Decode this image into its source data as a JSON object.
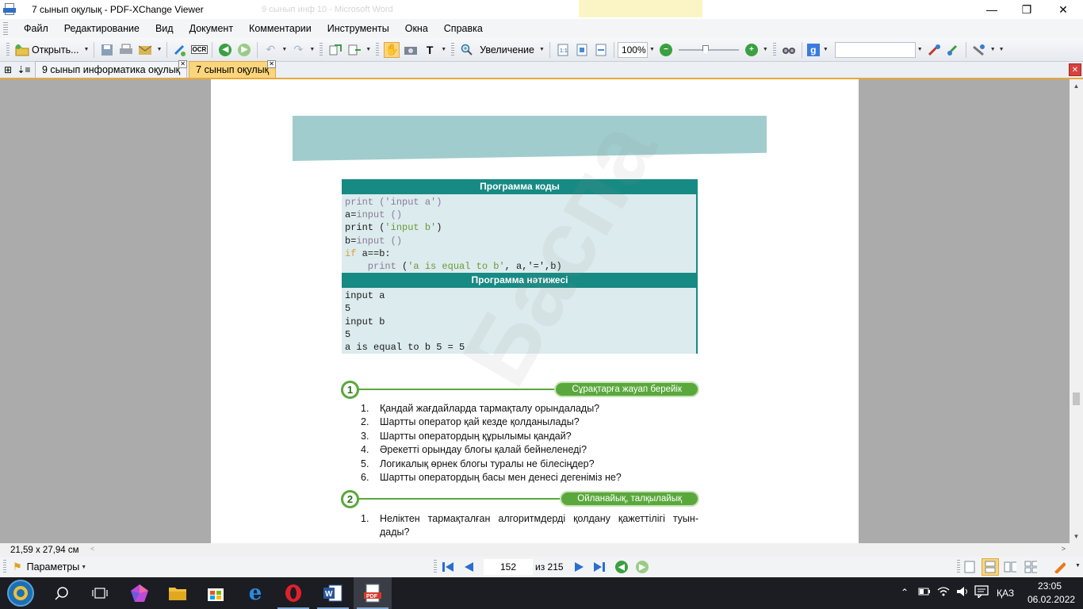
{
  "window": {
    "title": "7 сынып оқулық - PDF-XChange Viewer",
    "background_window_title": "9 сынып инф 10 - Microsoft Word",
    "minimize": "—",
    "maximize": "❐",
    "close": "✕"
  },
  "menu": [
    "Файл",
    "Редактирование",
    "Вид",
    "Документ",
    "Комментарии",
    "Инструменты",
    "Окна",
    "Справка"
  ],
  "toolbar": {
    "open_label": "Открыть...",
    "ocr_label": "OCR",
    "zoom_tool_label": "Увеличение",
    "zoom_value": "100%",
    "search_value": ""
  },
  "tabs": [
    {
      "label": "9 сынып информатика оқулық",
      "active": false
    },
    {
      "label": "7 сынып оқулық",
      "active": true
    }
  ],
  "document": {
    "watermark": "Баспа",
    "code_header": "Программа коды",
    "code_lines": [
      [
        {
          "t": "print ",
          "c": "kw-fn"
        },
        {
          "t": "('input a')",
          "c": "kw-fn"
        }
      ],
      [
        {
          "t": "a=",
          "c": "plain"
        },
        {
          "t": "input",
          "c": "kw-fn"
        },
        {
          "t": " ()",
          "c": "kw-fn"
        }
      ],
      [
        {
          "t": "print ",
          "c": "plain"
        },
        {
          "t": "(",
          "c": "plain"
        },
        {
          "t": "'input b'",
          "c": "kw-str"
        },
        {
          "t": ")",
          "c": "plain"
        }
      ],
      [
        {
          "t": "b=",
          "c": "plain"
        },
        {
          "t": "input",
          "c": "kw-fn"
        },
        {
          "t": " ()",
          "c": "kw-fn"
        }
      ],
      [
        {
          "t": "if ",
          "c": "kw-if"
        },
        {
          "t": "a==b:",
          "c": "plain"
        }
      ],
      [
        {
          "t": "    print ",
          "c": "kw-fn"
        },
        {
          "t": "(",
          "c": "plain"
        },
        {
          "t": "'a is equal to b'",
          "c": "kw-str"
        },
        {
          "t": ", a,'=',b)",
          "c": "plain"
        }
      ]
    ],
    "output_header": "Программа нәтижесі",
    "output_lines": [
      "input a",
      "5",
      "input b",
      "5",
      "a is equal to b 5 = 5"
    ],
    "section1": {
      "number": "1",
      "title": "Сұрақтарға жауап берейік",
      "questions": [
        "Қандай жағдайларда  тармақталу орындалады?",
        "Шартты оператор қай кезде қолданылады?",
        "Шартты оператордың құрылымы қандай?",
        "Әрекетті орындау блогы қалай бейнеленеді?",
        "Логикалық өрнек блогы туралы не білесіңдер?",
        "Шартты оператордың басы мен денесі дегеніміз не?"
      ]
    },
    "section2": {
      "number": "2",
      "title": "Ойланайық, талқылайық",
      "questions": [
        "Неліктен  тармақталған  алгоритмдерді  қолдану  қажеттілігі  туын-дады?"
      ]
    }
  },
  "status": {
    "page_size": "21,59 x 27,94 см"
  },
  "navbar": {
    "options_label": "Параметры",
    "current_page": "152",
    "total_pages": "из 215"
  },
  "taskbar": {
    "language": "ҚАЗ",
    "time": "23:05",
    "date": "06.02.2022"
  }
}
